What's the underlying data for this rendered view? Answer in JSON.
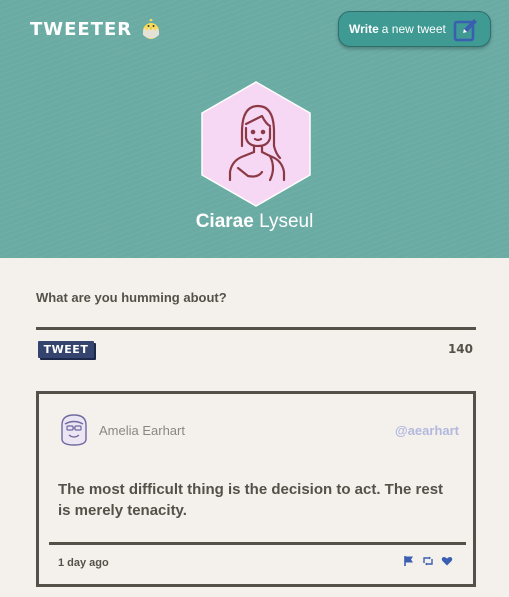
{
  "header": {
    "brand": "TWEETER",
    "brand_icon": "chick-icon",
    "write_button": {
      "strong": "Write",
      "rest": "a new tweet",
      "icon": "pencil-square-icon"
    },
    "colors": {
      "header_bg": "#6aaba4",
      "button_bg": "#3e9a93"
    }
  },
  "profile": {
    "first_name": "Ciarae",
    "last_name": "Lyseul",
    "avatar_icon": "user-avatar-icon"
  },
  "compose": {
    "prompt": "What are you humming about?",
    "tweet_button": "TWEET",
    "counter": "140"
  },
  "tweets": [
    {
      "name": "Amelia Earhart",
      "handle": "@aearhart",
      "text": "The most difficult thing is the decision to act. The rest is merely tenacity.",
      "time": "1 day ago",
      "actions": [
        "flag-icon",
        "retweet-icon",
        "heart-icon"
      ]
    }
  ]
}
